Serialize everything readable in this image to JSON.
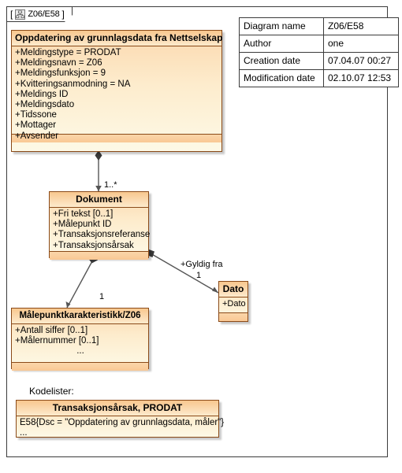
{
  "frame": {
    "tab_bracket_open": "[",
    "tab_bracket_close": "]",
    "tab_title": "Z06/E58",
    "tab_icon": "class-diagram-icon"
  },
  "info_table": {
    "rows": [
      {
        "key": "Diagram name",
        "value": "Z06/E58"
      },
      {
        "key": "Author",
        "value": "one"
      },
      {
        "key": "Creation date",
        "value": "07.04.07 00:27"
      },
      {
        "key": "Modification date",
        "value": "02.10.07 12:53"
      }
    ]
  },
  "classes": {
    "oppdatering": {
      "name": "Oppdatering av grunnlagsdata fra Nettselskap",
      "attributes": [
        "+Meldingstype = PRODAT",
        "+Meldingsnavn = Z06",
        "+Meldingsfunksjon = 9",
        "+Kvitteringsanmodning = NA",
        "+Meldings ID",
        "+Meldingsdato",
        "+Tidssone",
        "+Mottager",
        "+Avsender"
      ]
    },
    "dokument": {
      "name": "Dokument",
      "attributes": [
        "+Fri tekst [0..1]",
        "+Målepunkt ID",
        "+Transaksjonsreferanse",
        "+Transaksjonsårsak"
      ]
    },
    "malepunkt": {
      "name": "Målepunktkarakteristikk/Z06",
      "attributes": [
        "+Antall siffer [0..1]",
        "+Målernummer [0..1]"
      ],
      "continuation": "..."
    },
    "dato": {
      "name": "Dato",
      "attributes": [
        "+Dato"
      ]
    },
    "kodeliste": {
      "name": "Transaksjonsårsak, PRODAT",
      "attributes": [
        "E58{Dsc = \"Oppdatering av grunnlagsdata, måler\"}",
        "..."
      ]
    }
  },
  "labels": {
    "kodelister": "Kodelister:",
    "mult_oppdatering_dokument": "1..*",
    "mult_dokument_malepunkt": "1",
    "role_gyldig_fra": "+Gyldig fra",
    "mult_dokument_dato": "1"
  },
  "colors": {
    "class_border": "#8a4a18",
    "class_header_top": "#f8c78e",
    "class_body_bottom": "#fdf9e6",
    "frame_border": "#3b3b3b",
    "connector": "#555555",
    "background": "#ffffff"
  }
}
